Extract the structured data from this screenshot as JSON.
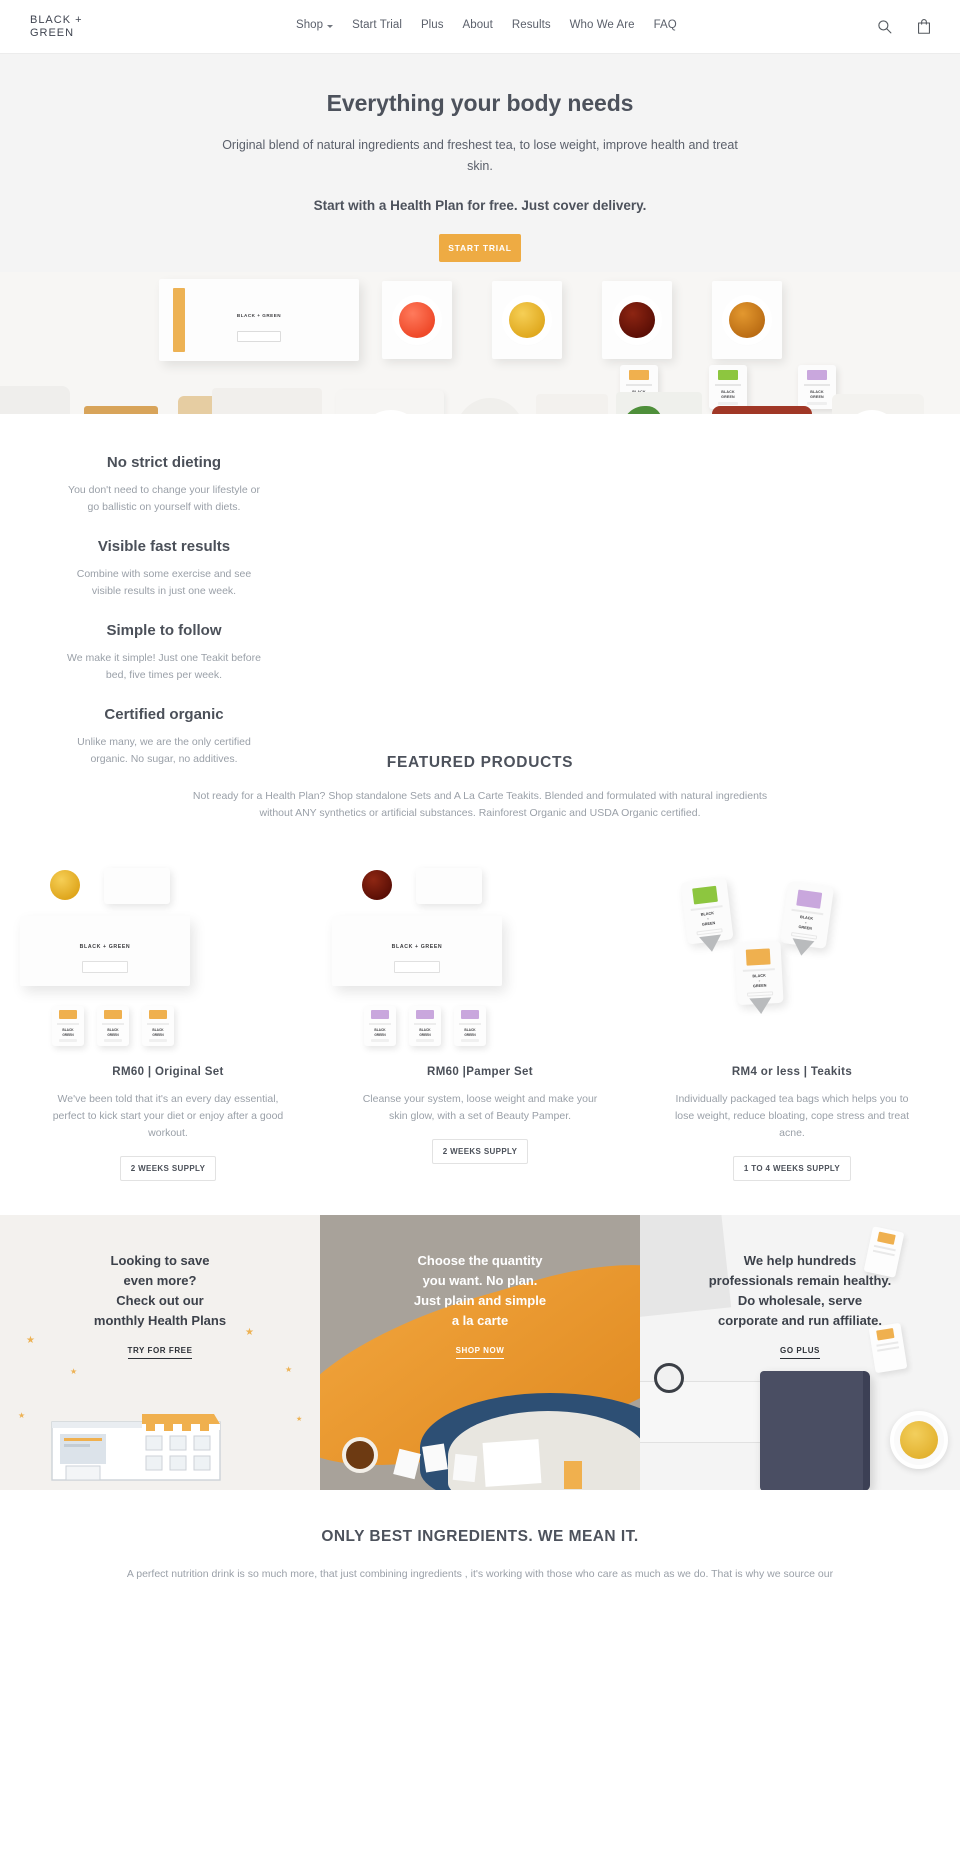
{
  "header": {
    "brand_line1": "BLACK +",
    "brand_line2": "GREEN",
    "nav": [
      {
        "label": "Shop",
        "has_caret": true
      },
      {
        "label": "Start Trial",
        "has_caret": false
      },
      {
        "label": "Plus",
        "has_caret": false
      },
      {
        "label": "About",
        "has_caret": false
      },
      {
        "label": "Results",
        "has_caret": false
      },
      {
        "label": "Who We Are",
        "has_caret": false
      },
      {
        "label": "FAQ",
        "has_caret": false
      }
    ],
    "search_icon": "search-icon",
    "cart_icon": "shopping-bag-icon"
  },
  "hero": {
    "title": "Everything your body needs",
    "subtitle": "Original blend of natural ingredients and freshest tea, to lose weight, improve health and treat skin.",
    "emphasis": "Start with a Health Plan for free. Just cover delivery.",
    "cta_label": "START TRIAL",
    "cta_color": "#eeab43",
    "product_box_label": "BLACK + GREEN",
    "cup_colors": [
      "#f2502f",
      "#e7b12c",
      "#6d1409",
      "#c4761a"
    ],
    "sachet_band_colors": [
      "#f0b04e",
      "#8dc63f",
      "#c9a7dd"
    ],
    "sachet_name_top": "BLACK",
    "sachet_name_bottom": "GREEN"
  },
  "benefits": [
    {
      "title": "No strict dieting",
      "text": "You don't need to change your lifestyle or go ballistic on yourself with diets."
    },
    {
      "title": "Visible fast results",
      "text": "Combine with some exercise and see visible results in just one week."
    },
    {
      "title": "Simple to follow",
      "text": "We make it simple! Just one Teakit before bed, five times per week."
    },
    {
      "title": "Certified organic",
      "text": "Unlike many, we are the only certified organic. No sugar, no additives."
    }
  ],
  "featured": {
    "title": "FEATURED PRODUCTS",
    "subtitle": "Not ready for a Health Plan? Shop standalone Sets and A La Carte Teakits. Blended and formulated with natural ingredients without ANY synthetics or artificial substances. Rainforest Organic and USDA Organic certified.",
    "products": [
      {
        "name": "RM60 | Original Set",
        "description": "We've been told that it's an every day essential, perfect to kick start your diet or enjoy after a good workout.",
        "tag": "2 WEEKS SUPPLY",
        "box_label": "BLACK + GREEN",
        "accent": "#e7b12c"
      },
      {
        "name": "RM60 |Pamper Set",
        "description": "Cleanse your system, loose weight and make your skin glow, with a set of Beauty Pamper.",
        "tag": "2 WEEKS SUPPLY",
        "box_label": "BLACK + GREEN",
        "accent": "#6d1409"
      },
      {
        "name": "RM4 or less | Teakits",
        "description": "Individually packaged tea bags which helps you to lose weight, reduce bloating, cope stress and treat acne.",
        "tag": "1 TO 4 WEEKS SUPPLY",
        "box_label": "BLACK + GREEN",
        "accent": "#8dc63f"
      }
    ]
  },
  "promos": [
    {
      "heading": "Looking to save\neven more?\nCheck out our\nmonthly Health Plans",
      "lines": [
        "Looking to save",
        "even more?",
        "Check out our",
        "monthly Health Plans"
      ],
      "link": "TRY FOR FREE",
      "theme": "light"
    },
    {
      "lines": [
        "Choose the quantity",
        "you want. No plan.",
        "Just plain and simple",
        "a la carte"
      ],
      "link": "SHOP NOW",
      "theme": "photo"
    },
    {
      "lines": [
        "We help hundreds",
        "professionals remain healthy.",
        "Do wholesale, serve",
        "corporate and run affiliate."
      ],
      "link": "GO PLUS",
      "theme": "light"
    }
  ],
  "bottom": {
    "title": "ONLY BEST INGREDIENTS. WE MEAN IT.",
    "text": "A perfect nutrition drink is so much more, that just combining ingredients , it's working with those who care as much as we do. That is why we source our"
  }
}
